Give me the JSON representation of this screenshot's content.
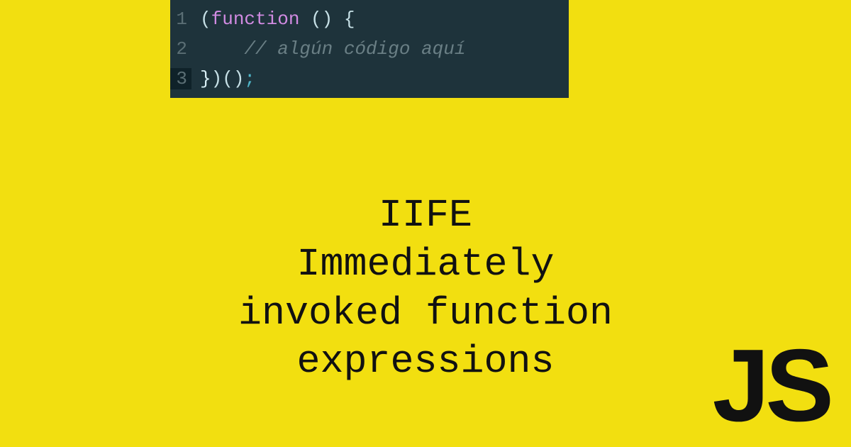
{
  "code": {
    "lines": [
      {
        "num": "1",
        "active": false
      },
      {
        "num": "2",
        "active": false
      },
      {
        "num": "3",
        "active": true
      }
    ],
    "line1": {
      "open_paren": "(",
      "keyword": "function",
      "rest": " () {"
    },
    "line2": {
      "indent": "    ",
      "comment": "// algún código aquí"
    },
    "line3": {
      "close_brace": "}",
      "parens": ")()",
      "semi": ";"
    }
  },
  "title": {
    "l1": "IIFE",
    "l2": "Immediately",
    "l3": "invoked function",
    "l4": "expressions"
  },
  "logo": "JS"
}
